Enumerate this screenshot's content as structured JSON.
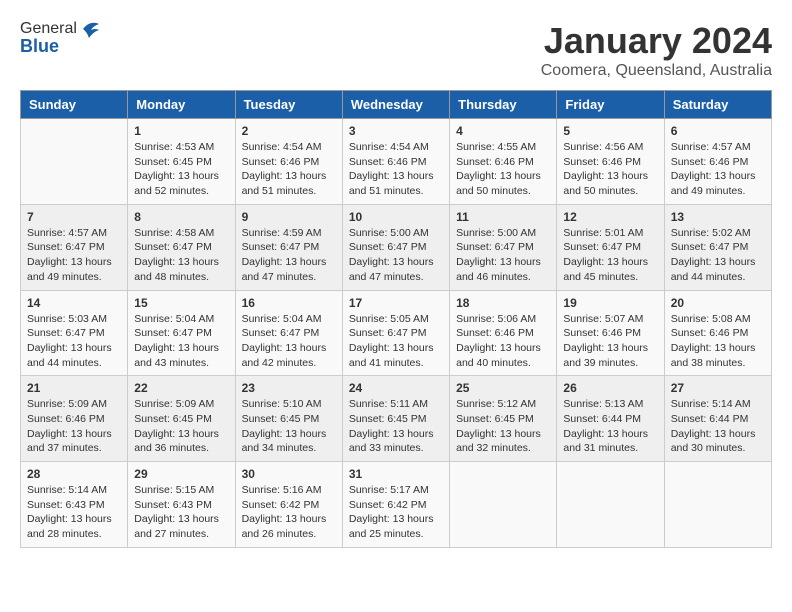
{
  "header": {
    "logo_general": "General",
    "logo_blue": "Blue",
    "month_title": "January 2024",
    "location": "Coomera, Queensland, Australia"
  },
  "days_of_week": [
    "Sunday",
    "Monday",
    "Tuesday",
    "Wednesday",
    "Thursday",
    "Friday",
    "Saturday"
  ],
  "weeks": [
    [
      {
        "day": "",
        "content": ""
      },
      {
        "day": "1",
        "content": "Sunrise: 4:53 AM\nSunset: 6:45 PM\nDaylight: 13 hours\nand 52 minutes."
      },
      {
        "day": "2",
        "content": "Sunrise: 4:54 AM\nSunset: 6:46 PM\nDaylight: 13 hours\nand 51 minutes."
      },
      {
        "day": "3",
        "content": "Sunrise: 4:54 AM\nSunset: 6:46 PM\nDaylight: 13 hours\nand 51 minutes."
      },
      {
        "day": "4",
        "content": "Sunrise: 4:55 AM\nSunset: 6:46 PM\nDaylight: 13 hours\nand 50 minutes."
      },
      {
        "day": "5",
        "content": "Sunrise: 4:56 AM\nSunset: 6:46 PM\nDaylight: 13 hours\nand 50 minutes."
      },
      {
        "day": "6",
        "content": "Sunrise: 4:57 AM\nSunset: 6:46 PM\nDaylight: 13 hours\nand 49 minutes."
      }
    ],
    [
      {
        "day": "7",
        "content": "Sunrise: 4:57 AM\nSunset: 6:47 PM\nDaylight: 13 hours\nand 49 minutes."
      },
      {
        "day": "8",
        "content": "Sunrise: 4:58 AM\nSunset: 6:47 PM\nDaylight: 13 hours\nand 48 minutes."
      },
      {
        "day": "9",
        "content": "Sunrise: 4:59 AM\nSunset: 6:47 PM\nDaylight: 13 hours\nand 47 minutes."
      },
      {
        "day": "10",
        "content": "Sunrise: 5:00 AM\nSunset: 6:47 PM\nDaylight: 13 hours\nand 47 minutes."
      },
      {
        "day": "11",
        "content": "Sunrise: 5:00 AM\nSunset: 6:47 PM\nDaylight: 13 hours\nand 46 minutes."
      },
      {
        "day": "12",
        "content": "Sunrise: 5:01 AM\nSunset: 6:47 PM\nDaylight: 13 hours\nand 45 minutes."
      },
      {
        "day": "13",
        "content": "Sunrise: 5:02 AM\nSunset: 6:47 PM\nDaylight: 13 hours\nand 44 minutes."
      }
    ],
    [
      {
        "day": "14",
        "content": "Sunrise: 5:03 AM\nSunset: 6:47 PM\nDaylight: 13 hours\nand 44 minutes."
      },
      {
        "day": "15",
        "content": "Sunrise: 5:04 AM\nSunset: 6:47 PM\nDaylight: 13 hours\nand 43 minutes."
      },
      {
        "day": "16",
        "content": "Sunrise: 5:04 AM\nSunset: 6:47 PM\nDaylight: 13 hours\nand 42 minutes."
      },
      {
        "day": "17",
        "content": "Sunrise: 5:05 AM\nSunset: 6:47 PM\nDaylight: 13 hours\nand 41 minutes."
      },
      {
        "day": "18",
        "content": "Sunrise: 5:06 AM\nSunset: 6:46 PM\nDaylight: 13 hours\nand 40 minutes."
      },
      {
        "day": "19",
        "content": "Sunrise: 5:07 AM\nSunset: 6:46 PM\nDaylight: 13 hours\nand 39 minutes."
      },
      {
        "day": "20",
        "content": "Sunrise: 5:08 AM\nSunset: 6:46 PM\nDaylight: 13 hours\nand 38 minutes."
      }
    ],
    [
      {
        "day": "21",
        "content": "Sunrise: 5:09 AM\nSunset: 6:46 PM\nDaylight: 13 hours\nand 37 minutes."
      },
      {
        "day": "22",
        "content": "Sunrise: 5:09 AM\nSunset: 6:45 PM\nDaylight: 13 hours\nand 36 minutes."
      },
      {
        "day": "23",
        "content": "Sunrise: 5:10 AM\nSunset: 6:45 PM\nDaylight: 13 hours\nand 34 minutes."
      },
      {
        "day": "24",
        "content": "Sunrise: 5:11 AM\nSunset: 6:45 PM\nDaylight: 13 hours\nand 33 minutes."
      },
      {
        "day": "25",
        "content": "Sunrise: 5:12 AM\nSunset: 6:45 PM\nDaylight: 13 hours\nand 32 minutes."
      },
      {
        "day": "26",
        "content": "Sunrise: 5:13 AM\nSunset: 6:44 PM\nDaylight: 13 hours\nand 31 minutes."
      },
      {
        "day": "27",
        "content": "Sunrise: 5:14 AM\nSunset: 6:44 PM\nDaylight: 13 hours\nand 30 minutes."
      }
    ],
    [
      {
        "day": "28",
        "content": "Sunrise: 5:14 AM\nSunset: 6:43 PM\nDaylight: 13 hours\nand 28 minutes."
      },
      {
        "day": "29",
        "content": "Sunrise: 5:15 AM\nSunset: 6:43 PM\nDaylight: 13 hours\nand 27 minutes."
      },
      {
        "day": "30",
        "content": "Sunrise: 5:16 AM\nSunset: 6:42 PM\nDaylight: 13 hours\nand 26 minutes."
      },
      {
        "day": "31",
        "content": "Sunrise: 5:17 AM\nSunset: 6:42 PM\nDaylight: 13 hours\nand 25 minutes."
      },
      {
        "day": "",
        "content": ""
      },
      {
        "day": "",
        "content": ""
      },
      {
        "day": "",
        "content": ""
      }
    ]
  ]
}
